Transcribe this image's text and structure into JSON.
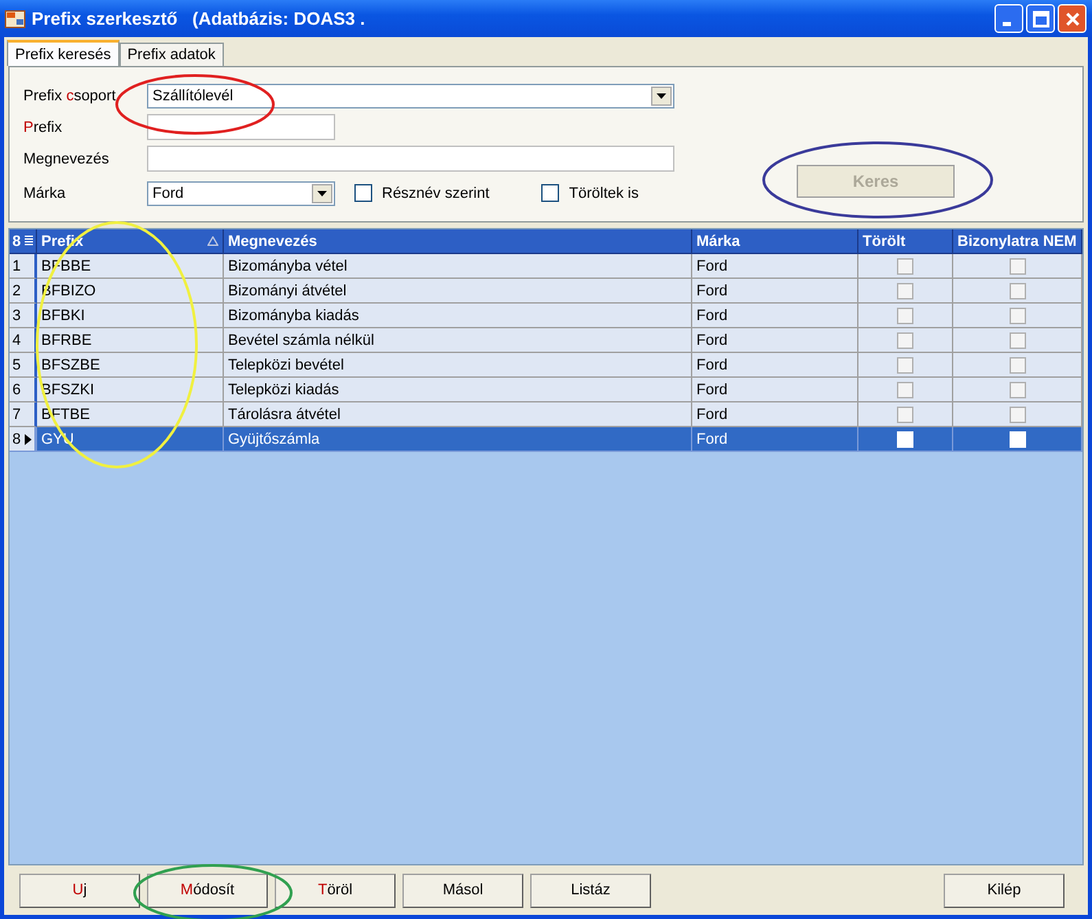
{
  "window": {
    "title": "Prefix szerkesztő   (Adatbázis: DOAS3 ."
  },
  "tabs": [
    {
      "label": "Prefix keresés",
      "selected": true
    },
    {
      "label": "Prefix adatok",
      "selected": false
    }
  ],
  "form": {
    "group": {
      "label": {
        "before": "Prefix ",
        "hot": "c",
        "after": "soport"
      },
      "value": "Szállítólevél"
    },
    "prefix": {
      "label": {
        "hot": "P",
        "after": "refix"
      }
    },
    "name": {
      "label": {
        "before": "Megnevezés"
      }
    },
    "brand": {
      "label": {
        "before": "Márka"
      },
      "value": "Ford"
    },
    "checks": [
      {
        "label": "Résznév szerint",
        "checked": false
      },
      {
        "label": "Töröltek is",
        "checked": false
      }
    ],
    "search_button": {
      "label": "Keres",
      "disabled": true
    }
  },
  "table": {
    "corner": "8",
    "columns": [
      "Prefix",
      "Megnevezés",
      "Márka",
      "Törölt",
      "Bizonylatra NEM"
    ],
    "rows": [
      {
        "num": "1",
        "prefix": "BFBBE",
        "name": "Bizományba vétel",
        "brand": "Ford",
        "deleted": false,
        "not_on_doc": false,
        "selected": false
      },
      {
        "num": "2",
        "prefix": "BFBIZO",
        "name": "Bizományi átvétel",
        "brand": "Ford",
        "deleted": false,
        "not_on_doc": false,
        "selected": false
      },
      {
        "num": "3",
        "prefix": "BFBKI",
        "name": "Bizományba kiadás",
        "brand": "Ford",
        "deleted": false,
        "not_on_doc": false,
        "selected": false
      },
      {
        "num": "4",
        "prefix": "BFRBE",
        "name": "Bevétel számla nélkül",
        "brand": "Ford",
        "deleted": false,
        "not_on_doc": false,
        "selected": false
      },
      {
        "num": "5",
        "prefix": "BFSZBE",
        "name": "Telepközi bevétel",
        "brand": "Ford",
        "deleted": false,
        "not_on_doc": false,
        "selected": false
      },
      {
        "num": "6",
        "prefix": "BFSZKI",
        "name": "Telepközi kiadás",
        "brand": "Ford",
        "deleted": false,
        "not_on_doc": false,
        "selected": false
      },
      {
        "num": "7",
        "prefix": "BFTBE",
        "name": "Tárolásra átvétel",
        "brand": "Ford",
        "deleted": false,
        "not_on_doc": false,
        "selected": false
      },
      {
        "num": "8",
        "prefix": "GYU",
        "name": "Gyüjtőszámla",
        "brand": "Ford",
        "deleted": false,
        "not_on_doc": false,
        "selected": true
      }
    ]
  },
  "buttons": [
    {
      "hot": "U",
      "after": "j"
    },
    {
      "hot": "M",
      "after": "ódosít"
    },
    {
      "hot": "T",
      "after": "öröl"
    },
    {
      "before": "Másol"
    },
    {
      "before": "Listáz"
    }
  ],
  "exit_button": "Kilép",
  "annotations": [
    {
      "color": "#e02020"
    },
    {
      "color": "#3a3a9a"
    },
    {
      "color": "#f0f040"
    },
    {
      "color": "#30a050"
    }
  ]
}
